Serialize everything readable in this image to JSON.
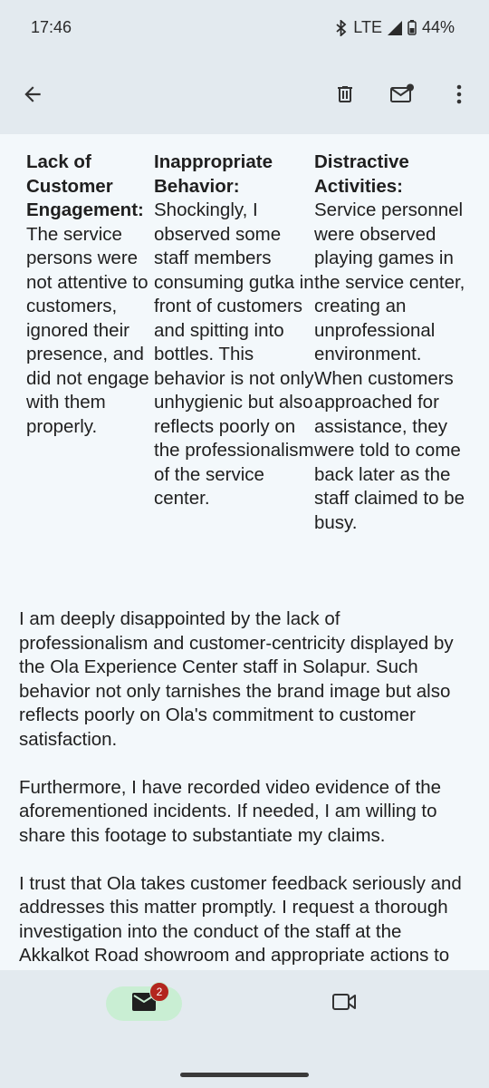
{
  "status_bar": {
    "time": "17:46",
    "network": "LTE",
    "battery": "44%",
    "icons": [
      "bluetooth-icon",
      "signal-icon",
      "battery-icon"
    ]
  },
  "app_bar": {
    "icons": [
      "back-arrow-icon",
      "delete-icon",
      "mark-unread-icon",
      "more-vert-icon"
    ]
  },
  "columns": [
    {
      "title": "Lack of Customer Engagement:",
      "body": "The service persons were not attentive to customers, ignored their presence, and did not engage with them properly."
    },
    {
      "title": "Inappropriate Behavior:",
      "body": "Shockingly, I observed some staff members consuming gutka in front of customers and spitting into bottles. This behavior is not only unhygienic but also reflects poorly on the professionalism of the service center."
    },
    {
      "title": "Distractive Activities:",
      "body": "Service personnel were observed playing games in the service center, creating an unprofessional environment. When customers approached for assistance, they were told to come back later as the staff claimed to be busy."
    }
  ],
  "paragraphs": [
    "I am deeply disappointed by the lack of professionalism and customer-centricity displayed by the Ola Experience Center staff in Solapur. Such behavior not only tarnishes the brand image but also reflects poorly on Ola's commitment to customer satisfaction.",
    "Furthermore, I have recorded video evidence of the aforementioned incidents. If needed, I am willing to share this footage to substantiate my claims.",
    "I trust that Ola takes customer feedback seriously and addresses this matter promptly. I request a thorough investigation into the conduct of the staff at the Akkalkot Road showroom and appropriate actions to ensure a more positive and"
  ],
  "bottom_nav": {
    "mail_badge": "2",
    "icons": [
      "mail-icon",
      "video-icon"
    ]
  },
  "colors": {
    "background": "#f3f8fb",
    "bars": "#e3eaef",
    "active_pill": "#c9eed3",
    "badge": "#b3261e"
  }
}
